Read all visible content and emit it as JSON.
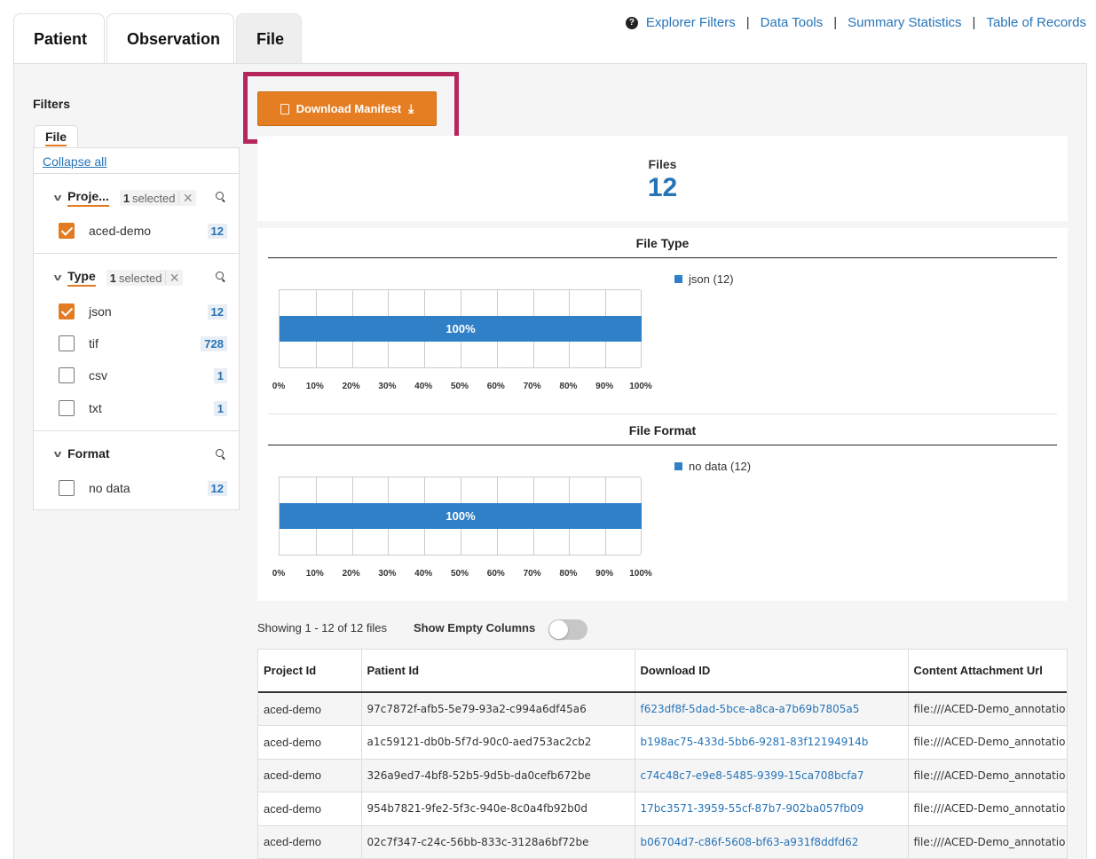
{
  "tabs": [
    {
      "label": "Patient",
      "active": false
    },
    {
      "label": "Observation",
      "active": false
    },
    {
      "label": "File",
      "active": true
    }
  ],
  "toplinks": {
    "help_icon": "question-circle-icon",
    "explorer_filters": "Explorer Filters",
    "data_tools": "Data Tools",
    "summary_statistics": "Summary Statistics",
    "table_of_records": "Table of Records",
    "separator": "|"
  },
  "sidebar": {
    "title": "Filters",
    "filter_tab": "File",
    "collapse_all": "Collapse all",
    "sections": [
      {
        "title": "Proje...",
        "selected_count": "1",
        "selected_label": "selected",
        "options": [
          {
            "label": "aced-demo",
            "count": "12",
            "checked": true
          }
        ]
      },
      {
        "title": "Type",
        "selected_count": "1",
        "selected_label": "selected",
        "options": [
          {
            "label": "json",
            "count": "12",
            "checked": true
          },
          {
            "label": "tif",
            "count": "728",
            "checked": false
          },
          {
            "label": "csv",
            "count": "1",
            "checked": false
          },
          {
            "label": "txt",
            "count": "1",
            "checked": false
          }
        ]
      },
      {
        "title": "Format",
        "options": [
          {
            "label": "no data",
            "count": "12",
            "checked": false
          }
        ]
      }
    ]
  },
  "download_button": {
    "label": "Download Manifest",
    "icon": "download-arrow-icon"
  },
  "files_summary": {
    "label": "Files",
    "count": "12"
  },
  "chart_data": [
    {
      "type": "bar",
      "title": "File Type",
      "categories": [
        "json"
      ],
      "values": [
        100
      ],
      "data_labels": [
        "100%"
      ],
      "legend": [
        {
          "name": "json",
          "count": "(12)"
        }
      ],
      "xlim": [
        0,
        100
      ],
      "ticks": [
        "0%",
        "10%",
        "20%",
        "30%",
        "40%",
        "50%",
        "60%",
        "70%",
        "80%",
        "90%",
        "100%"
      ],
      "grid": true,
      "legend_position": "right",
      "color": "#3080c8"
    },
    {
      "type": "bar",
      "title": "File Format",
      "categories": [
        "no data"
      ],
      "values": [
        100
      ],
      "data_labels": [
        "100%"
      ],
      "legend": [
        {
          "name": "no data",
          "count": "(12)"
        }
      ],
      "xlim": [
        0,
        100
      ],
      "ticks": [
        "0%",
        "10%",
        "20%",
        "30%",
        "40%",
        "50%",
        "60%",
        "70%",
        "80%",
        "90%",
        "100%"
      ],
      "grid": true,
      "legend_position": "right",
      "color": "#3080c8"
    }
  ],
  "table_controls": {
    "showing": "Showing 1 - 12 of 12 files",
    "show_empty_columns": "Show Empty Columns",
    "show_empty_on": false
  },
  "table": {
    "columns": [
      "Project Id",
      "Patient Id",
      "Download ID",
      "Content Attachment Url"
    ],
    "rows": [
      [
        "aced-demo",
        "97c7872f-afb5-5e79-93a2-c994a6df45a6",
        "f623df8f-5dad-5bce-a8ca-a7b69b7805a5",
        "file:///ACED-Demo_annotatio"
      ],
      [
        "aced-demo",
        "a1c59121-db0b-5f7d-90c0-aed753ac2cb2",
        "b198ac75-433d-5bb6-9281-83f12194914b",
        "file:///ACED-Demo_annotatio"
      ],
      [
        "aced-demo",
        "326a9ed7-4bf8-52b5-9d5b-da0cefb672be",
        "c74c48c7-e9e8-5485-9399-15ca708bcfa7",
        "file:///ACED-Demo_annotatio"
      ],
      [
        "aced-demo",
        "954b7821-9fe2-5f3c-940e-8c0a4fb92b0d",
        "17bc3571-3959-55cf-87b7-902ba057fb09",
        "file:///ACED-Demo_annotatio"
      ],
      [
        "aced-demo",
        "02c7f347-c24c-56bb-833c-3128a6bf72be",
        "b06704d7-c86f-5608-bf63-a931f8ddfd62",
        "file:///ACED-Demo_annotatio"
      ]
    ]
  },
  "colors": {
    "accent": "#e27b21",
    "link": "#2674b8",
    "bar": "#3080c8",
    "highlight_frame": "#b5275c"
  }
}
